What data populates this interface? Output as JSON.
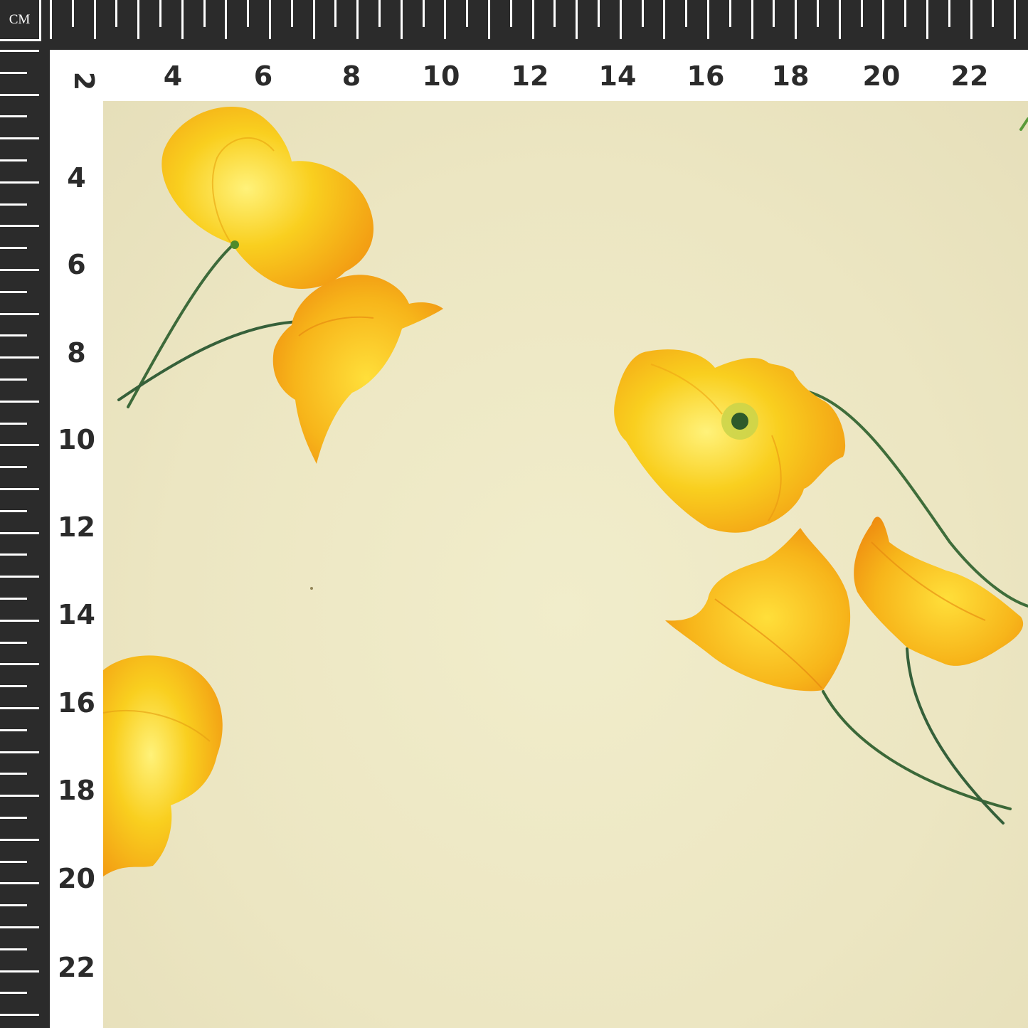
{
  "ruler": {
    "unit": "CM",
    "top_labels": [
      "2",
      "4",
      "6",
      "8",
      "10",
      "12",
      "14",
      "16",
      "18",
      "20",
      "22"
    ],
    "left_labels": [
      "4",
      "6",
      "8",
      "10",
      "12",
      "14",
      "16",
      "18",
      "20",
      "22"
    ]
  },
  "colors": {
    "ruler": "#2b2b2b",
    "tick": "#ffffff",
    "fabric": "#ede7c4",
    "petal": "#f7c21a",
    "petal_deep": "#f39a12",
    "stem": "#3f6b3a"
  }
}
